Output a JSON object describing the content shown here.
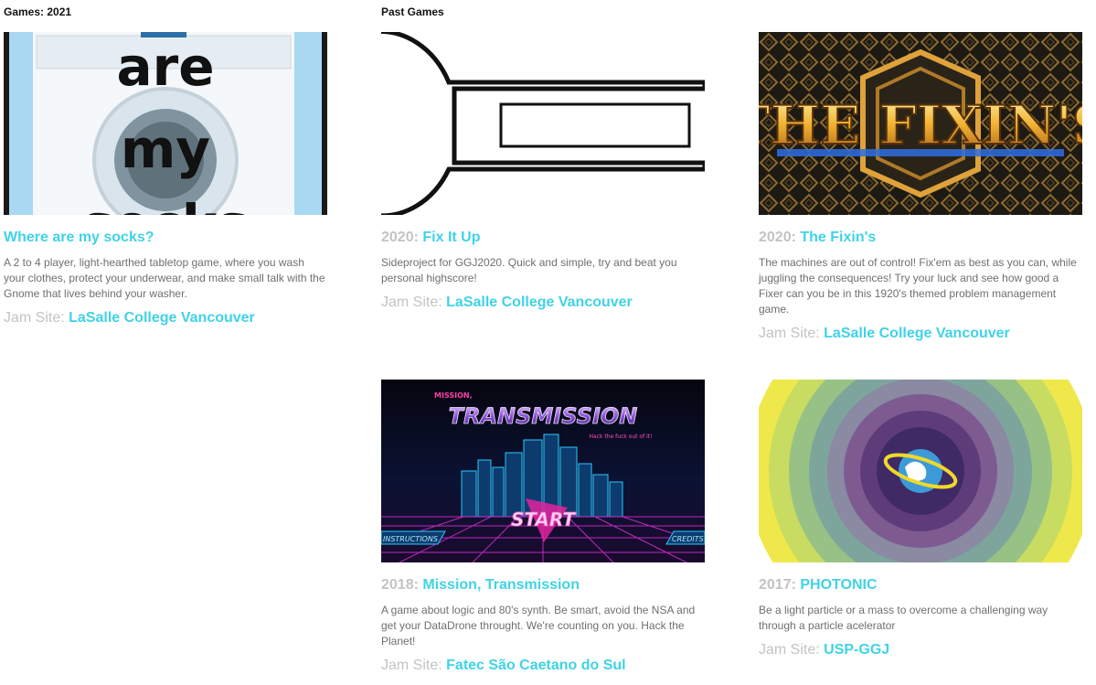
{
  "sections": {
    "current_title": "Games: 2021",
    "past_title": "Past Games"
  },
  "thumb_texts": {
    "socks_line1": "are",
    "socks_line2": "my",
    "socks_line3": "socks",
    "fixins_logo": "THE FIXIN'S",
    "mission_small": "MISSION,",
    "mission_big": "TRANSMISSION",
    "mission_tag": "Hack the fuck out of it!",
    "mission_start": "START",
    "mission_left": "INSTRUCTIONS",
    "mission_right": "CREDITS"
  },
  "jam_site_label": "Jam Site:",
  "games": [
    {
      "year": "",
      "title": "Where are my socks?",
      "description": "A 2 to 4 player, light-hearthed tabletop game, where you wash your clothes, protect your underwear, and make small talk with the Gnome that lives behind your washer.",
      "site": "LaSalle College Vancouver"
    },
    {
      "year": "2020:",
      "title": "Fix It Up",
      "description": "Sideproject for GGJ2020. Quick and simple, try and beat you personal highscore!",
      "site": "LaSalle College Vancouver"
    },
    {
      "year": "2020:",
      "title": "The Fixin's",
      "description": "The machines are out of control! Fix'em as best as you can, while juggling the consequences! Try your luck and see how good a Fixer can you be in this 1920's themed problem management game.",
      "site": "LaSalle College Vancouver"
    },
    {
      "year": "2018:",
      "title": "Mission, Transmission",
      "description": "A game about logic and 80's synth. Be smart, avoid the NSA and get your DataDrone throught. We're counting on you. Hack the Planet!",
      "site": "Fatec São Caetano do Sul"
    },
    {
      "year": "2017:",
      "title": "PHOTONIC",
      "description": "Be a light particle or a mass to overcome a challenging way through a particle acelerator",
      "site": "USP-GGJ"
    }
  ],
  "colors": {
    "link": "#3fd3e6",
    "muted": "#c3c3c3",
    "body_text": "#6f6f6f"
  }
}
